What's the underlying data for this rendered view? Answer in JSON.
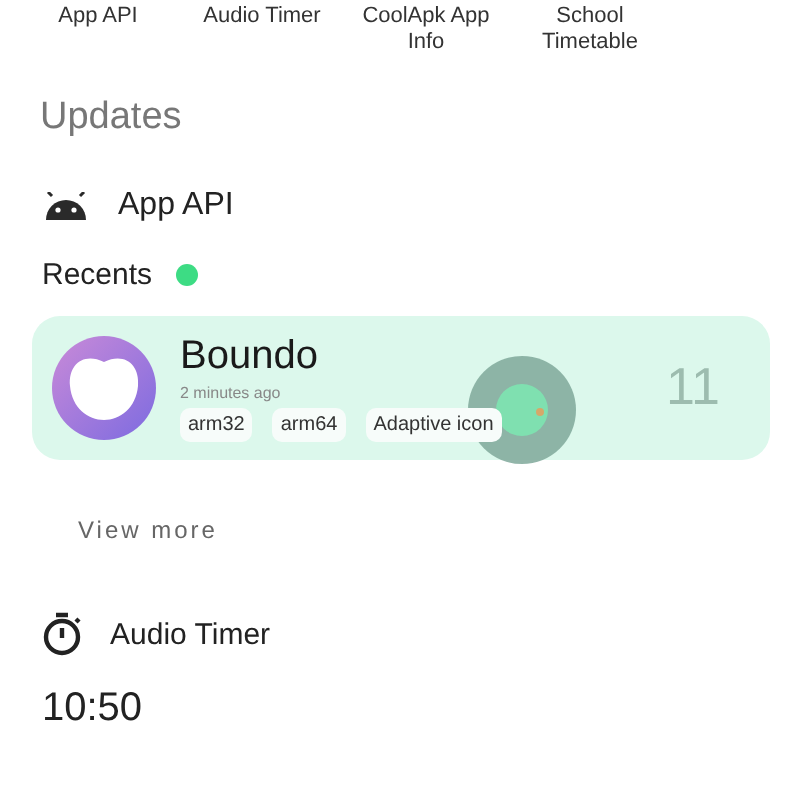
{
  "shortcuts": [
    {
      "label": "App API"
    },
    {
      "label": "Audio Timer"
    },
    {
      "label": "CoolApk App Info"
    },
    {
      "label": "School Timetable"
    }
  ],
  "updates": {
    "title": "Updates",
    "app_api": {
      "title": "App API",
      "recents_label": "Recents",
      "recents_active": true,
      "card": {
        "name": "Boundo",
        "time": "2 minutes ago",
        "tags": [
          "arm32",
          "arm64",
          "Adaptive icon"
        ],
        "target_sdk": "11"
      },
      "view_more": "View more"
    },
    "audio_timer": {
      "title": "Audio Timer",
      "time": "10:50"
    }
  }
}
